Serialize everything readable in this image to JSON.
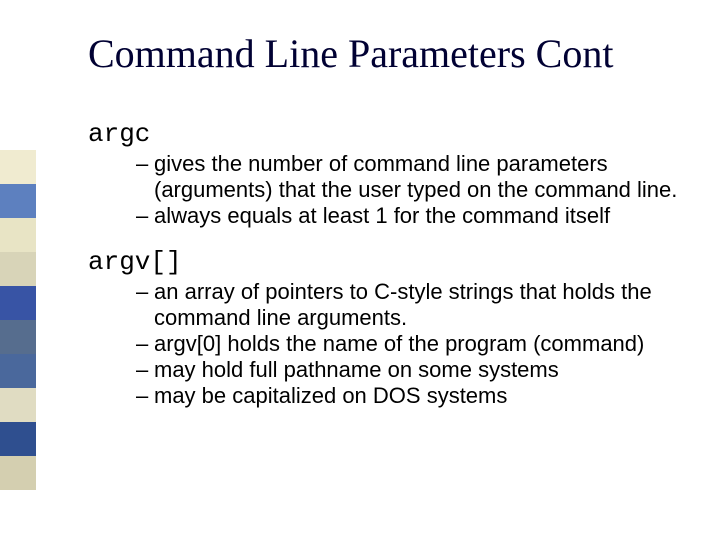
{
  "title": "Command Line Parameters Cont",
  "sections": [
    {
      "label": "argc",
      "bullets": [
        "gives the number of command line parameters (arguments) that the user typed on the command line.",
        "always equals at least 1 for the command itself"
      ]
    },
    {
      "label": "argv[]",
      "bullets": [
        "an array of pointers to C-style strings that holds the command line arguments.",
        "argv[0] holds the name of the program (command)",
        "may hold full pathname on some systems",
        "may be capitalized on DOS systems"
      ]
    }
  ]
}
